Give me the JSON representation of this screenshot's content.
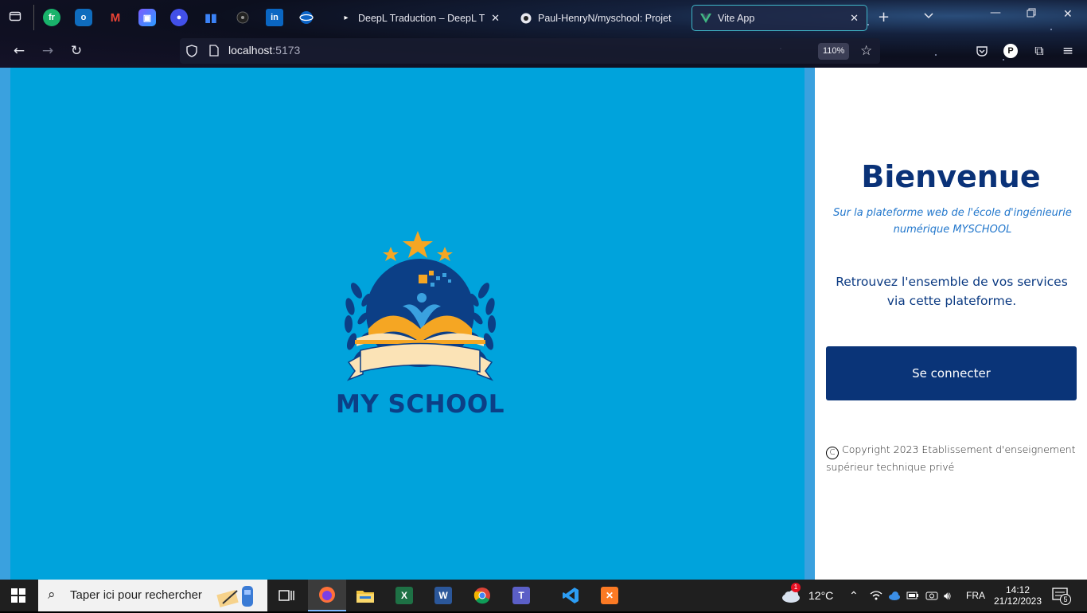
{
  "browser": {
    "tabs": [
      {
        "label": "DeepL Traduction – DeepL Trans",
        "active": false
      },
      {
        "label": "Paul-HenryN/myschool: Projet",
        "active": false
      },
      {
        "label": "Vite App",
        "active": true
      }
    ],
    "url_host": "localhost",
    "url_port": ":5173",
    "zoom": "110%",
    "profile_initial": "P",
    "pinned_icons": [
      "fr-icon",
      "outlook-icon",
      "gmail-icon",
      "planner-icon",
      "record-icon",
      "analytics-icon",
      "circle-icon",
      "linkedin-icon",
      "sphere-icon"
    ]
  },
  "page": {
    "logo_text": "MY SCHOOL",
    "title": "Bienvenue",
    "subtitle": "Sur la plateforme web de l'école d'ingénieurie numérique MYSCHOOL",
    "services_text": "Retrouvez l'ensemble de vos services via cette plateforme.",
    "login_button": "Se connecter",
    "copyright_symbol": "C",
    "copyright": "Copyright 2023 Etablissement d'enseignement supérieur technique privé"
  },
  "taskbar": {
    "search_placeholder": "Taper ici pour rechercher",
    "weather_temp": "12°C",
    "weather_badge": "1",
    "language": "FRA",
    "time": "14:12",
    "date": "21/12/2023",
    "notification_count": "5"
  },
  "colors": {
    "left_panel": "#00a3dc",
    "brand_dark_blue": "#0a3478",
    "subtitle_blue": "#2277cc",
    "tab_active_border": "#3fb7c9"
  }
}
